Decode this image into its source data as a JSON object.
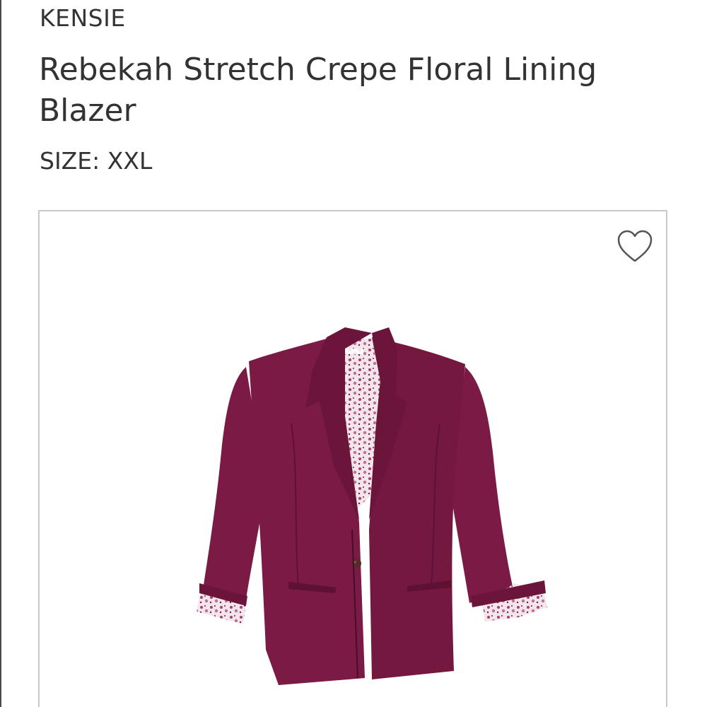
{
  "product": {
    "brand": "KENSIE",
    "name": "Rebekah Stretch Crepe Floral Lining Blazer",
    "size_label": "SIZE:",
    "size_value": "XXL",
    "size_text": "SIZE: XXL"
  },
  "image": {
    "subject": "burgundy-blazer",
    "favorite_icon": "heart-outline-icon",
    "colors": {
      "blazer": "#7b1a45",
      "blazer_shadow": "#5e1133",
      "lining": "#f2e6ec",
      "lining_print": "#a8406e",
      "icon_stroke": "#555555",
      "card_border": "#c9c9c9"
    }
  }
}
